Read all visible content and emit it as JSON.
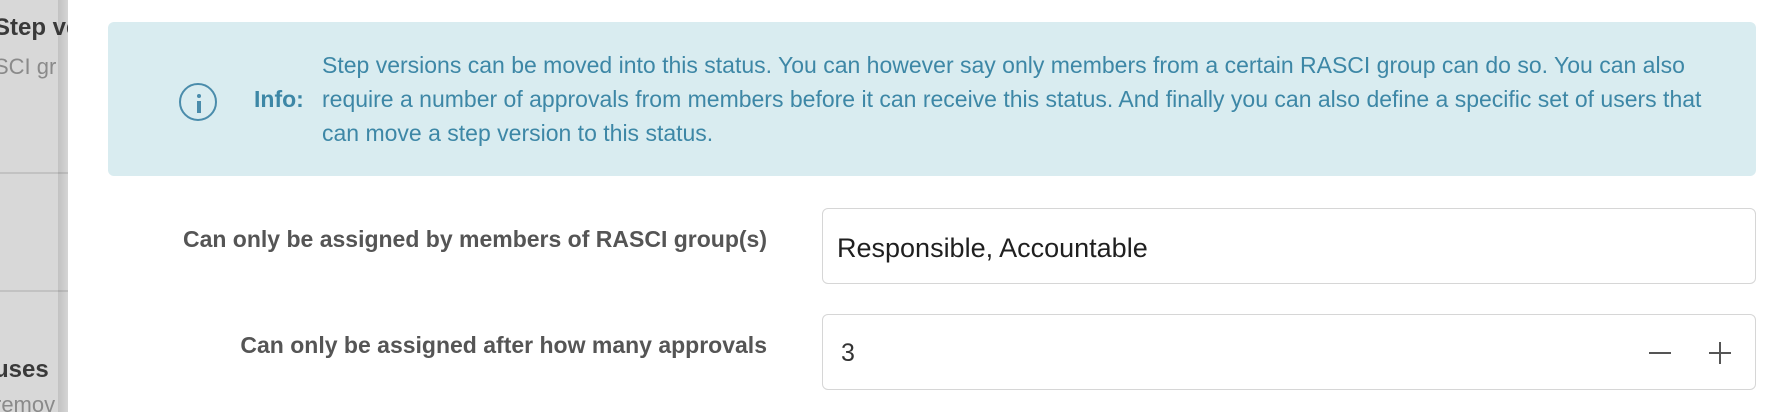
{
  "background_page": {
    "section1_title": "Step ve",
    "section1_subtitle": "SCI gr",
    "section2_title": "uses",
    "section2_subtitle": "remov"
  },
  "info_alert": {
    "icon": "info-circle-icon",
    "label": "Info:",
    "message": "Step versions can be moved into this status. You can however say only members from a certain RASCI group can do so. You can also require a number of approvals from members before it can receive this status. And finally you can also define a specific set of users that can move a step version to this status."
  },
  "form": {
    "rasci_groups": {
      "label": "Can only be assigned by members of RASCI group(s)",
      "value": "Responsible, Accountable"
    },
    "approvals": {
      "label": "Can only be assigned after how many approvals",
      "value": "3",
      "decrement_icon": "minus-icon",
      "increment_icon": "plus-icon"
    }
  },
  "colors": {
    "alert_background": "#d9ecf0",
    "alert_text": "#3d87a6",
    "label_text": "#555555",
    "field_border": "#d6d6d6"
  }
}
